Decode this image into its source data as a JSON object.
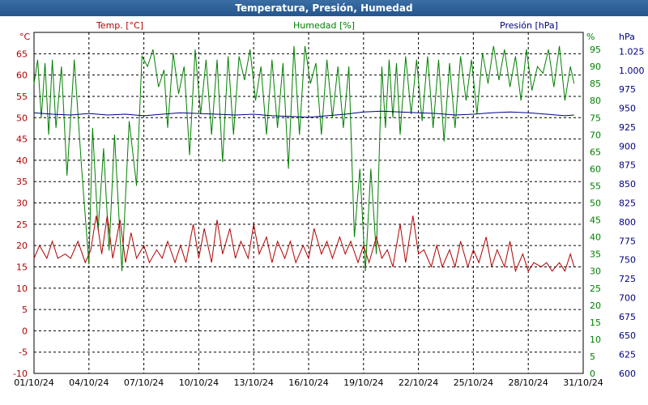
{
  "window": {
    "title": "Temperatura, Presión, Humedad"
  },
  "chart_data": {
    "type": "line",
    "title": "Temperatura, Presión, Humedad",
    "grid": true,
    "colors": {
      "temp": "#b00000",
      "hum": "#008000",
      "pres": "#000080"
    },
    "axes": {
      "temp": {
        "label": "Temp. [°C]",
        "unit": "°C",
        "ylim": [
          -10,
          70
        ],
        "ticks": [
          "65",
          "60",
          "55",
          "50",
          "45",
          "40",
          "35",
          "30",
          "25",
          "20",
          "15",
          "10",
          "5",
          "0",
          "-5",
          "-10"
        ]
      },
      "hum": {
        "label": "Humedad [%]",
        "unit": "%",
        "ylim": [
          0,
          100
        ],
        "ticks": [
          "95",
          "90",
          "85",
          "80",
          "75",
          "70",
          "65",
          "60",
          "55",
          "50",
          "45",
          "40",
          "35",
          "30",
          "25",
          "20",
          "15",
          "10",
          "5",
          "0"
        ]
      },
      "pres": {
        "label": "Presión [hPa]",
        "unit": "hPa",
        "ylim": [
          600,
          1050
        ],
        "ticks": [
          "1.025",
          "1.000",
          "975",
          "950",
          "925",
          "900",
          "875",
          "850",
          "825",
          "800",
          "775",
          "750",
          "725",
          "700",
          "675",
          "650",
          "625",
          "600"
        ]
      }
    },
    "x": {
      "xlim": [
        0,
        30
      ],
      "ticks": [
        "01/10/24",
        "04/10/24",
        "07/10/24",
        "10/10/24",
        "13/10/24",
        "16/10/24",
        "19/10/24",
        "22/10/24",
        "25/10/24",
        "28/10/24",
        "31/10/24"
      ]
    },
    "series": [
      {
        "name": "Temp. [°C]",
        "axis": "temp",
        "color": "#b00000",
        "x": [
          0,
          0.3,
          0.7,
          1,
          1.3,
          1.7,
          2,
          2.4,
          2.8,
          3.1,
          3.4,
          3.7,
          4,
          4.3,
          4.7,
          5,
          5.3,
          5.6,
          6,
          6.3,
          6.7,
          7,
          7.3,
          7.7,
          8,
          8.3,
          8.7,
          9,
          9.3,
          9.7,
          10,
          10.3,
          10.7,
          11,
          11.3,
          11.7,
          12,
          12.3,
          12.7,
          13,
          13.3,
          13.7,
          14,
          14.3,
          14.7,
          15,
          15.3,
          15.7,
          16,
          16.3,
          16.7,
          17,
          17.3,
          17.7,
          18,
          18.3,
          18.7,
          19,
          19.3,
          19.6,
          20,
          20.3,
          20.7,
          21,
          21.3,
          21.7,
          22,
          22.3,
          22.7,
          23,
          23.3,
          23.7,
          24,
          24.3,
          24.7,
          25,
          25.3,
          25.7,
          26,
          26.3,
          26.7,
          27,
          27.3,
          27.7,
          28,
          28.3,
          28.7,
          29,
          29.3,
          29.5
        ],
        "values": [
          17,
          20,
          17,
          21,
          17,
          18,
          17,
          21,
          16,
          19,
          27,
          18,
          27,
          17,
          26,
          16,
          23,
          17,
          20,
          16,
          19,
          17,
          21,
          16,
          20,
          16,
          25,
          17,
          24,
          16,
          26,
          18,
          24,
          17,
          21,
          17,
          25,
          18,
          22,
          16,
          21,
          17,
          21,
          16,
          20,
          17,
          24,
          18,
          21,
          17,
          22,
          18,
          21,
          16,
          20,
          16,
          22,
          17,
          19,
          15,
          25,
          16,
          27,
          18,
          19,
          15,
          20,
          15,
          19,
          15,
          21,
          15,
          19,
          16,
          22,
          15,
          19,
          15,
          21,
          14,
          18,
          14,
          16,
          15,
          16,
          14,
          16,
          14,
          18,
          15
        ]
      },
      {
        "name": "Humedad [%]",
        "axis": "hum",
        "color": "#008000",
        "x": [
          0,
          0.2,
          0.4,
          0.6,
          0.8,
          1,
          1.2,
          1.5,
          1.8,
          2.2,
          2.6,
          3,
          3.2,
          3.5,
          3.8,
          4.1,
          4.4,
          4.8,
          5.2,
          5.6,
          5.9,
          6.2,
          6.5,
          6.8,
          7.1,
          7.3,
          7.6,
          7.9,
          8.2,
          8.5,
          8.8,
          9.1,
          9.4,
          9.7,
          10,
          10.3,
          10.6,
          10.9,
          11.2,
          11.5,
          11.8,
          12.1,
          12.4,
          12.7,
          13,
          13.3,
          13.6,
          13.9,
          14.2,
          14.5,
          14.8,
          15.1,
          15.4,
          15.7,
          16,
          16.3,
          16.6,
          16.9,
          17.2,
          17.5,
          17.8,
          18.1,
          18.4,
          18.7,
          19,
          19.2,
          19.4,
          19.6,
          19.8,
          20,
          20.3,
          20.6,
          20.9,
          21.2,
          21.5,
          21.8,
          22.1,
          22.4,
          22.7,
          23,
          23.3,
          23.6,
          23.9,
          24.2,
          24.5,
          24.8,
          25.1,
          25.4,
          25.7,
          26,
          26.3,
          26.6,
          26.9,
          27.2,
          27.5,
          27.8,
          28.1,
          28.4,
          28.7,
          29,
          29.3,
          29.5
        ],
        "values": [
          85,
          92,
          75,
          91,
          70,
          92,
          72,
          90,
          58,
          92,
          60,
          32,
          72,
          42,
          66,
          36,
          70,
          30,
          74,
          55,
          93,
          90,
          95,
          84,
          89,
          72,
          94,
          82,
          90,
          64,
          95,
          76,
          92,
          70,
          92,
          62,
          93,
          70,
          93,
          86,
          95,
          80,
          90,
          70,
          92,
          72,
          91,
          60,
          96,
          70,
          96,
          85,
          91,
          70,
          92,
          75,
          90,
          72,
          90,
          40,
          60,
          30,
          60,
          35,
          90,
          72,
          92,
          75,
          91,
          70,
          93,
          76,
          92,
          74,
          93,
          72,
          92,
          68,
          91,
          72,
          93,
          80,
          92,
          76,
          94,
          85,
          96,
          86,
          95,
          84,
          93,
          80,
          95,
          83,
          90,
          88,
          95,
          84,
          96,
          80,
          90,
          85
        ]
      },
      {
        "name": "Presión [hPa]",
        "axis": "pres",
        "color": "#000080",
        "x": [
          0,
          1,
          2,
          3,
          4,
          5,
          6,
          7,
          8,
          9,
          10,
          11,
          12,
          13,
          14,
          15,
          16,
          17,
          18,
          19,
          20,
          21,
          22,
          23,
          24,
          25,
          26,
          27,
          28,
          29,
          29.5
        ],
        "values": [
          944,
          942,
          941,
          943,
          941,
          942,
          940,
          942,
          944,
          943,
          942,
          941,
          942,
          940,
          939,
          938,
          940,
          942,
          945,
          946,
          945,
          944,
          943,
          941,
          942,
          944,
          945,
          944,
          942,
          940,
          941
        ]
      }
    ]
  }
}
